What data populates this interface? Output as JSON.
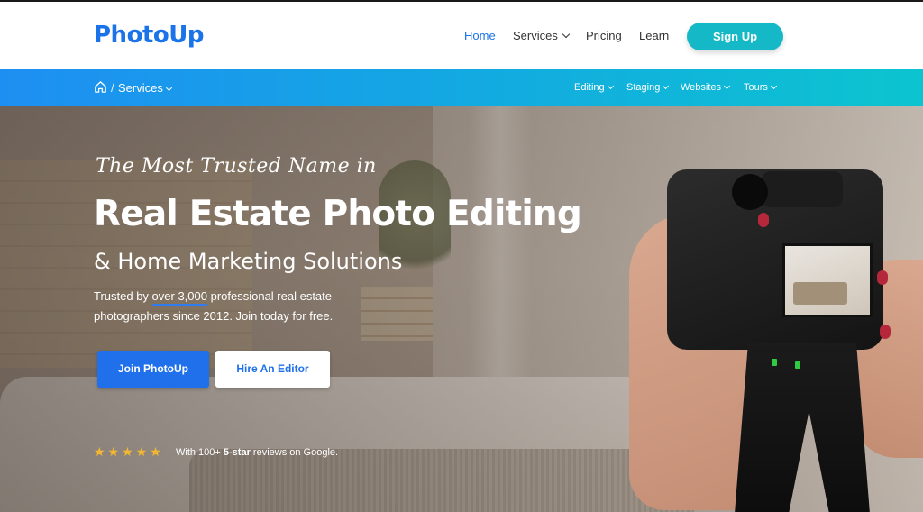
{
  "brand": {
    "logo": "PhotoUp",
    "accent": "#1a73e8",
    "cta_color": "#14b8c6"
  },
  "nav": {
    "home": "Home",
    "services": "Services",
    "pricing": "Pricing",
    "learn": "Learn",
    "signup": "Sign Up"
  },
  "subnav": {
    "home_icon": "home-icon",
    "separator": "/",
    "current": "Services",
    "links": [
      "Editing",
      "Staging",
      "Websites",
      "Tours"
    ]
  },
  "hero": {
    "tagline": "The Most Trusted Name in",
    "headline": "Real Estate Photo Editing",
    "subhead": "& Home Marketing Solutions",
    "desc_pre": "Trusted by ",
    "desc_highlight": "over 3,000",
    "desc_post": " professional real estate photographers since 2012. Join today for free.",
    "cta_primary": "Join PhotoUp",
    "cta_secondary": "Hire An Editor",
    "stars": "★★★★★",
    "rating_value": 5,
    "reviews_pre": "With 100+ ",
    "reviews_bold": "5-star",
    "reviews_post": " reviews on Google."
  }
}
